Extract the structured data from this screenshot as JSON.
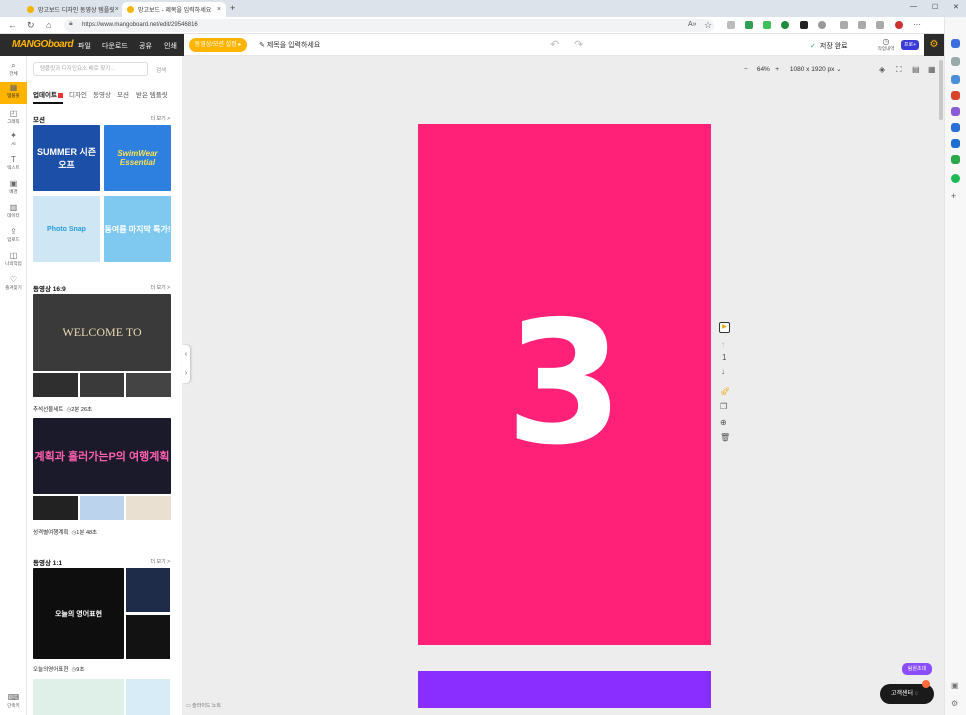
{
  "browser": {
    "tabs": [
      {
        "label": "망고보드 디자인 동영상 템플릿",
        "active": false
      },
      {
        "label": "망고보드 - 제목을 입력하세요",
        "active": true
      }
    ],
    "new_tab": "+",
    "url": "https://www.mangoboard.net/edit/29546816",
    "window_controls": [
      "—",
      "☐",
      "✕"
    ]
  },
  "app": {
    "logo": "MANGOboard",
    "menu": [
      "파일",
      "다운로드",
      "공유",
      "인쇄"
    ],
    "motion_button": "동영상/모션 설정 ▸",
    "title_placeholder": "제목을 입력하세요",
    "save_status": "저장 완료",
    "work_history": "작업내역",
    "plan_badge": "프로+"
  },
  "rail": [
    {
      "icon": "⌕",
      "label": "전체"
    },
    {
      "icon": "▦",
      "label": "템플릿",
      "active": true
    },
    {
      "icon": "◰",
      "label": "그래픽"
    },
    {
      "icon": "✦",
      "label": "AI"
    },
    {
      "icon": "T",
      "label": "텍스트"
    },
    {
      "icon": "▣",
      "label": "배경"
    },
    {
      "icon": "▥",
      "label": "데이터"
    },
    {
      "icon": "⇪",
      "label": "업로드"
    },
    {
      "icon": "◫",
      "label": "나의작업"
    },
    {
      "icon": "♡",
      "label": "즐겨찾기"
    },
    {
      "icon": "⌨",
      "label": "단축키"
    }
  ],
  "panel": {
    "search_placeholder": "템플릿과 디자인요소 배로 찾기...",
    "search_button": "검색",
    "tabs": [
      "업데이트",
      "디자인",
      "동영상",
      "모션",
      "받은 템플릿"
    ],
    "sections": [
      {
        "title": "모션",
        "more": "더 보기 >"
      },
      {
        "title": "동영상 16:9",
        "more": "더 보기 >"
      },
      {
        "title": "동영상 1:1",
        "more": "더 보기 >"
      }
    ],
    "thumbs_motion": [
      "SUMMER 시즌오프",
      "SwimWear Essential",
      "Photo Snap",
      "동여름 마지막 특가!"
    ],
    "video1_title": "WELCOME TO",
    "video1_caption": "추석선물세트",
    "video1_duration": "2분 26초",
    "video2_title": "계획과 흘러가는P의 여행계획",
    "video2_caption": "성격별여행계획",
    "video2_duration": "1분 48초",
    "video3_title": "오늘의 영어표현",
    "video3_caption": "오늘의영어표현",
    "video3_duration": "9초"
  },
  "canvas": {
    "zoom_minus": "−",
    "zoom": "64%",
    "zoom_plus": "+",
    "size": "1080 x 1920 px",
    "slide_number": "3",
    "page_index": "1",
    "slide_note": "슬라이드 노트",
    "help": "고객센터",
    "invite": "팀원초대",
    "page1_color": "#ff2178",
    "page2_color": "#8a2dff"
  }
}
